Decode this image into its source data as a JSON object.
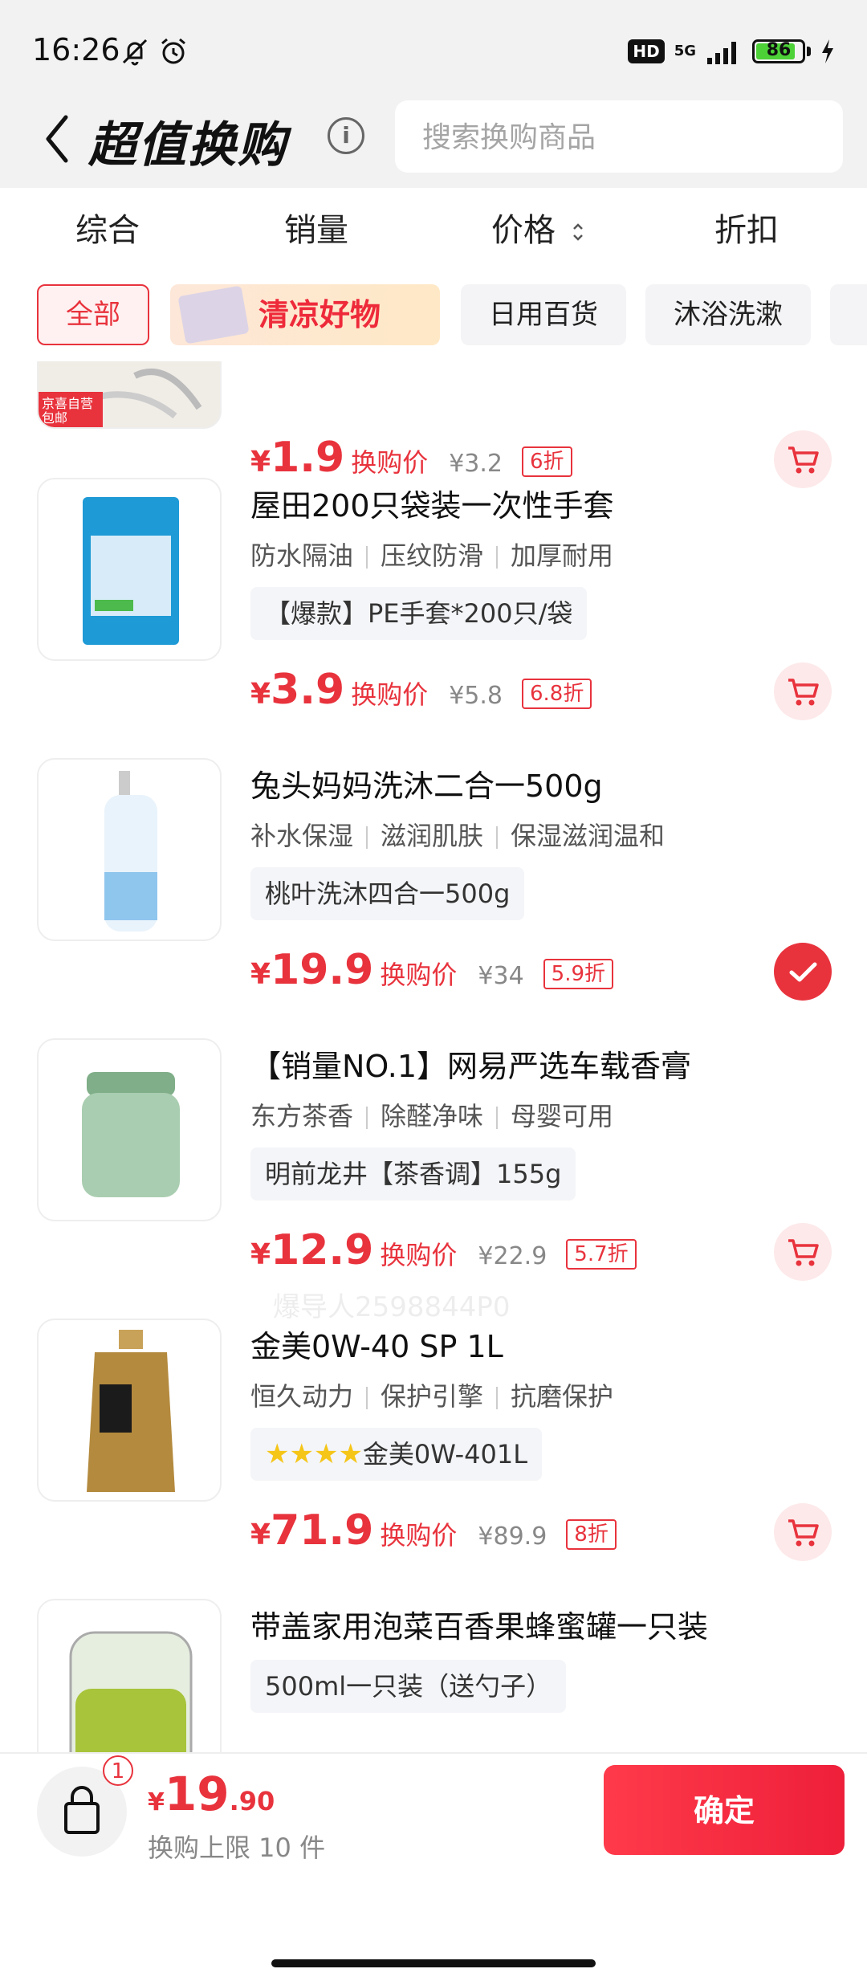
{
  "status_bar": {
    "time": "16:26",
    "hd_label": "HD",
    "network_label": "5G",
    "battery_level": 86,
    "battery_text": "86"
  },
  "header": {
    "title": "超值换购",
    "search_placeholder": "搜索换购商品"
  },
  "sort_tabs": [
    "综合",
    "销量",
    "价格",
    "折扣"
  ],
  "filter_chips": [
    {
      "label": "全部",
      "active": true
    },
    {
      "label": "清凉好物",
      "promo": true
    },
    {
      "label": "日用百货"
    },
    {
      "label": "沐浴洗漱"
    }
  ],
  "products": [
    {
      "title": "",
      "tags": [],
      "spec": "",
      "price": "1.9",
      "price_label": "换购价",
      "original_price": "¥3.2",
      "discount": "6折",
      "selected": false,
      "thumb_badge": "京喜自营包邮"
    },
    {
      "title": "屋田200只袋装一次性手套",
      "tags": [
        "防水隔油",
        "压纹防滑",
        "加厚耐用"
      ],
      "spec": "【爆款】PE手套*200只/袋",
      "price": "3.9",
      "price_label": "换购价",
      "original_price": "¥5.8",
      "discount": "6.8折",
      "selected": false
    },
    {
      "title": "兔头妈妈洗沐二合一500g",
      "tags": [
        "补水保湿",
        "滋润肌肤",
        "保湿滋润温和"
      ],
      "spec": "桃叶洗沐四合一500g",
      "price": "19.9",
      "price_label": "换购价",
      "original_price": "¥34",
      "discount": "5.9折",
      "selected": true
    },
    {
      "title": "【销量NO.1】网易严选车载香膏",
      "tags": [
        "东方茶香",
        "除醛净味",
        "母婴可用"
      ],
      "spec": "明前龙井【茶香调】155g",
      "price": "12.9",
      "price_label": "换购价",
      "original_price": "¥22.9",
      "discount": "5.7折",
      "selected": false
    },
    {
      "title": "金美0W-40 SP 1L",
      "tags": [
        "恒久动力",
        "保护引擎",
        "抗磨保护"
      ],
      "spec": "金美0W-401L",
      "spec_stars": 4,
      "price": "71.9",
      "price_label": "换购价",
      "original_price": "¥89.9",
      "discount": "8折",
      "selected": false
    },
    {
      "title": "带盖家用泡菜百香果蜂蜜罐一只装",
      "tags": [],
      "spec": "500ml一只装（送勺子）",
      "price": "",
      "price_label": "",
      "original_price": "",
      "discount": "",
      "selected": false
    }
  ],
  "watermark": "爆导人2598844P0",
  "bottom_bar": {
    "cart_count": "1",
    "total_yen": "¥",
    "total_int": "19",
    "total_dec": ".90",
    "limit_text": "换购上限 10 件",
    "confirm_label": "确定"
  },
  "colors": {
    "accent": "#e8333d",
    "top_background": "#f2f2f2"
  }
}
